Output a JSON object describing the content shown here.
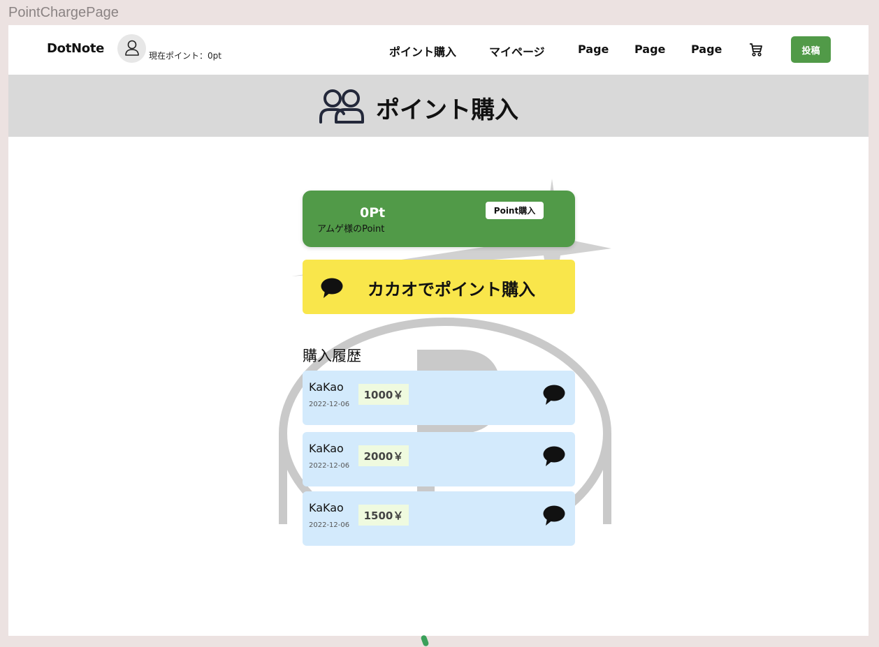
{
  "frame_label": "PointChargePage",
  "header": {
    "logo": "DotNote",
    "current_points": "現在ポイント：0pt",
    "nav": [
      "ポイント購入",
      "マイページ",
      "Page",
      "Page",
      "Page"
    ],
    "post_label": "投稿",
    "icons": {
      "avatar": "user-icon",
      "cart": "cart-icon"
    }
  },
  "title_band": {
    "title": "ポイント購入",
    "icon": "users-icon"
  },
  "point_card": {
    "points": "0Pt",
    "owner": "アムゲ様のPoint",
    "buy_label": "Point購入"
  },
  "kakao": {
    "label": "カカオでポイント購入",
    "icon": "chat-bubble-icon"
  },
  "history": {
    "title": "購入履歴",
    "rows": [
      {
        "name": "KaKao",
        "date": "2022-12-06",
        "amount": "1000￥"
      },
      {
        "name": "KaKao",
        "date": "2022-12-06",
        "amount": "2000￥"
      },
      {
        "name": "KaKao",
        "date": "2022-12-06",
        "amount": "1500￥"
      }
    ]
  },
  "colors": {
    "accent_green": "#519a48",
    "kakao_yellow": "#f9e64b",
    "history_row_bg": "#d3eafc",
    "amount_bg": "#effadf",
    "title_band_bg": "#d9d9d9"
  }
}
